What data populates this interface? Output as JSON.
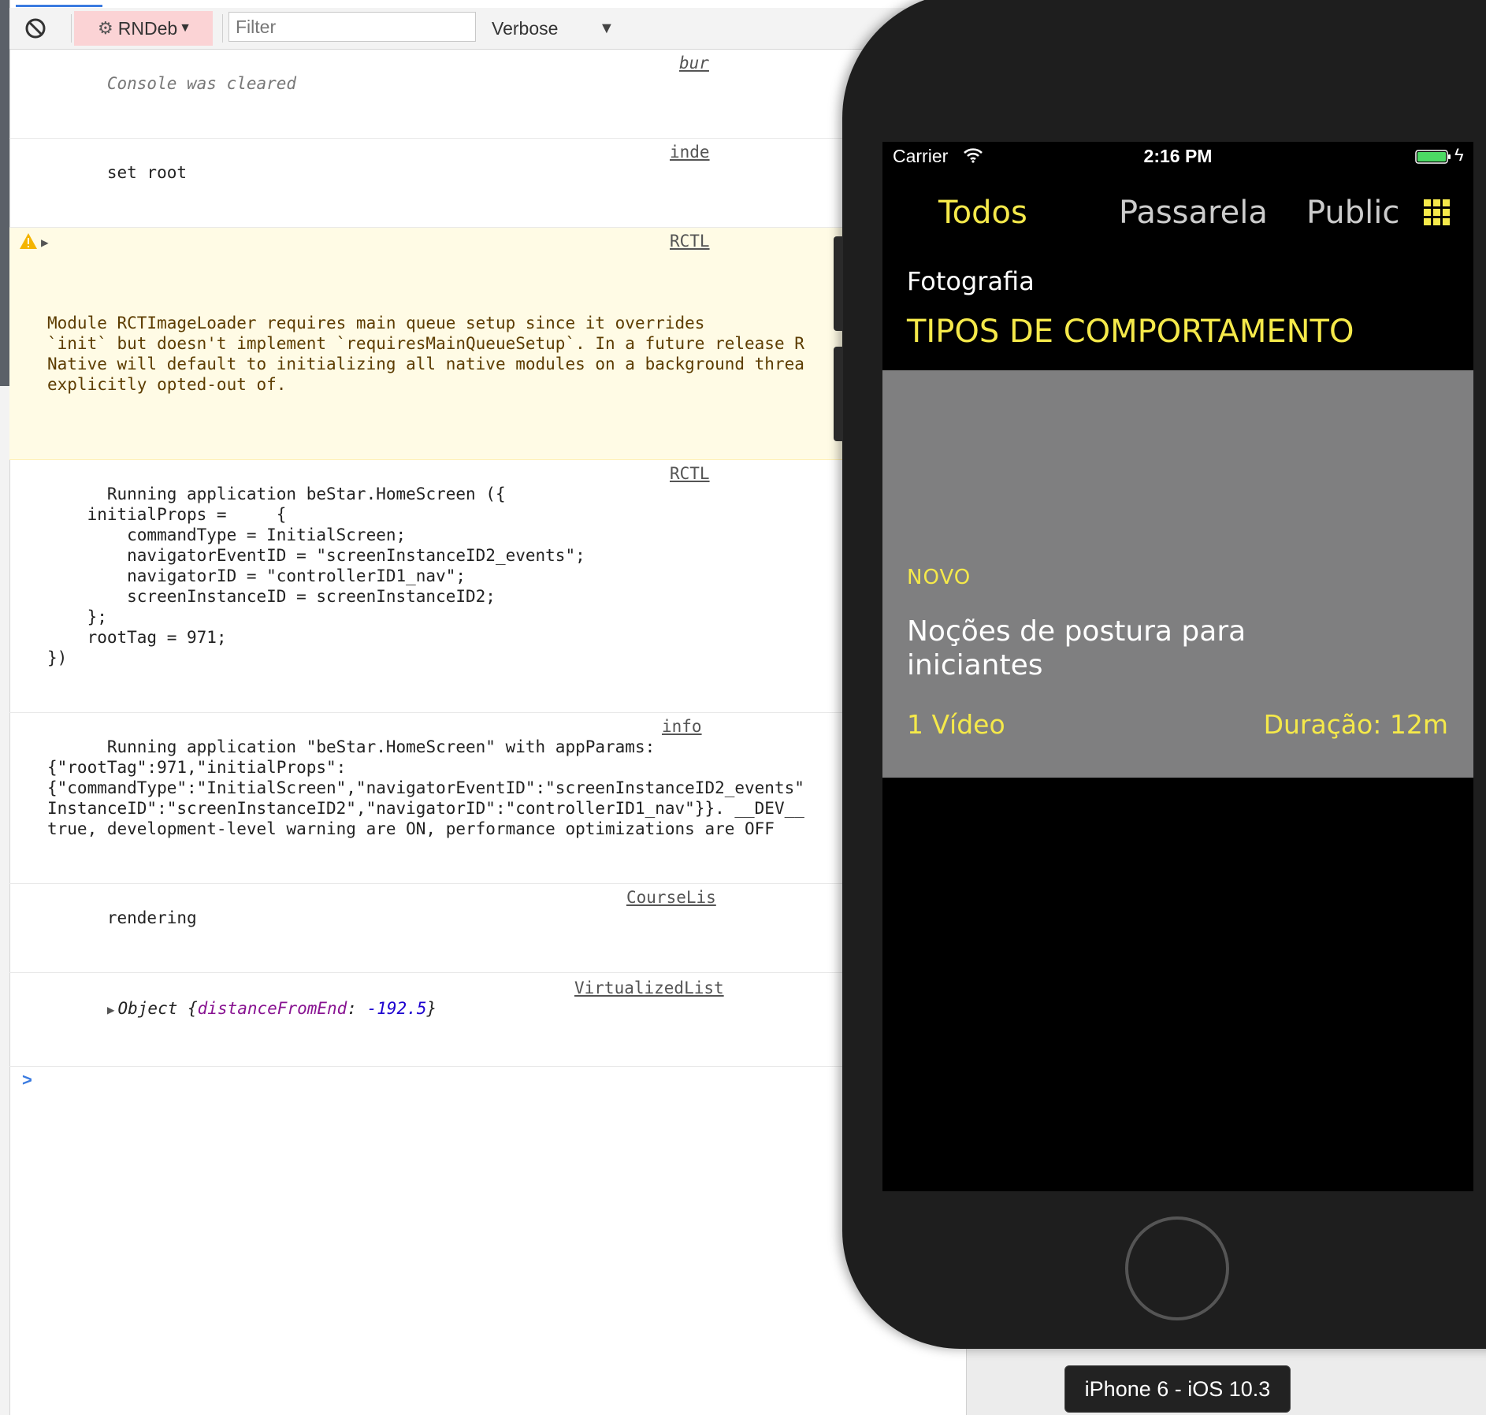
{
  "toolbar": {
    "context": "RNDeb",
    "filter_placeholder": "Filter",
    "level": "Verbose"
  },
  "console": [
    {
      "type": "cleared",
      "text": "Console was cleared",
      "source": "bur"
    },
    {
      "type": "log",
      "text": "set root",
      "source": "inde"
    },
    {
      "type": "warning",
      "text": "Module RCTImageLoader requires main queue setup since it overrides\n`init` but doesn't implement `requiresMainQueueSetup`. In a future release R\nNative will default to initializing all native modules on a background threa\nexplicitly opted-out of.",
      "source": "RCTL"
    },
    {
      "type": "log",
      "text": "Running application beStar.HomeScreen ({\n    initialProps =     {\n        commandType = InitialScreen;\n        navigatorEventID = \"screenInstanceID2_events\";\n        navigatorID = \"controllerID1_nav\";\n        screenInstanceID = screenInstanceID2;\n    };\n    rootTag = 971;\n})",
      "source": "RCTL"
    },
    {
      "type": "log",
      "text": "Running application \"beStar.HomeScreen\" with appParams:\n{\"rootTag\":971,\"initialProps\":\n{\"commandType\":\"InitialScreen\",\"navigatorEventID\":\"screenInstanceID2_events\"\nInstanceID\":\"screenInstanceID2\",\"navigatorID\":\"controllerID1_nav\"}}. __DEV__\ntrue, development-level warning are ON, performance optimizations are OFF",
      "source": "info"
    },
    {
      "type": "log",
      "text": "rendering",
      "source": "CourseLis"
    }
  ],
  "object_entry": {
    "label": "Object {",
    "key": "distanceFromEnd",
    "sep": ": ",
    "value": "-192.5",
    "close": "}",
    "source": "VirtualizedList"
  },
  "prompt": ">",
  "phone": {
    "status": {
      "carrier": "Carrier",
      "time": "2:16 PM"
    },
    "tabs": [
      {
        "label": "Todos",
        "active": true
      },
      {
        "label": "Passarela",
        "active": false
      },
      {
        "label": "Public",
        "active": false
      }
    ],
    "category": "Fotografia",
    "heading": "TIPOS DE COMPORTAMENTO",
    "course": {
      "badge": "NOVO",
      "title": "Noções de postura para iniciantes",
      "videos": "1 Vídeo",
      "duration": "Duração: 12m"
    }
  },
  "device_label": "iPhone 6 - iOS 10.3",
  "colors": {
    "accent_yellow": "#f5e94a",
    "card_gray": "#7f7f80",
    "context_bg": "#fbd3d5",
    "warning_bg": "#fffbe5",
    "battery_green": "#4cd964"
  }
}
